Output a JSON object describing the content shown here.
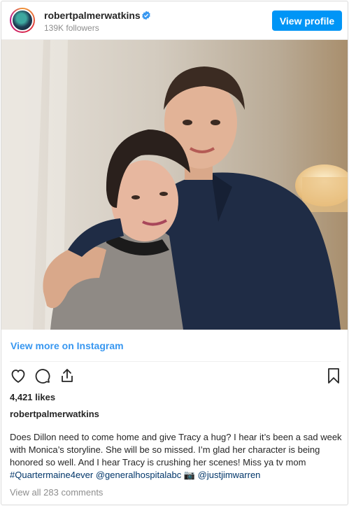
{
  "header": {
    "username": "robertpalmerwatkins",
    "followers": "139K followers",
    "view_profile_label": "View profile"
  },
  "post": {
    "view_more_label": "View more on Instagram",
    "likes": "4,421 likes",
    "caption_user": "robertpalmerwatkins",
    "caption_text": "Does Dillon need to come home and give Tracy a hug? I hear it’s been a sad week with Monica’s storyline. She will be so missed. I’m glad her character is being honored so well. And I hear Tracy is crushing her scenes! Miss ya tv mom",
    "hashtag": "#Quartermaine4ever",
    "mention1": "@generalhospitalabc",
    "camera_emoji": "📷",
    "mention2": "@justjimwarren",
    "view_comments": "View all 283 comments"
  },
  "colors": {
    "accent": "#0095f6",
    "link": "#3897f0",
    "tag": "#003569",
    "muted": "#8e8e8e"
  },
  "icons": [
    "verified-badge-icon",
    "heart-icon",
    "comment-icon",
    "share-icon",
    "bookmark-icon"
  ]
}
